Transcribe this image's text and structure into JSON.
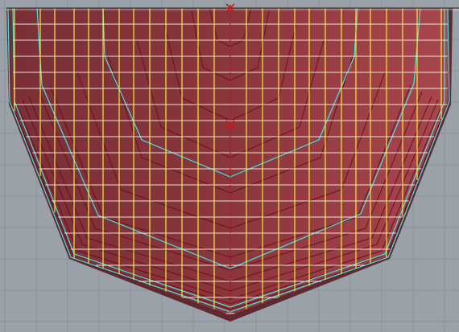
{
  "viewport": {
    "view": "3d-hull-viewport",
    "colors": {
      "background": "#9ba1a8",
      "background_grid": "#8c939b",
      "hull_fill": "#8f3a40",
      "hull_fill_light": "#a8454b",
      "hull_dark": "#5e2a30",
      "hull_edge": "#6e0f18",
      "waterline": "#ffffff",
      "station": "#f2e93a",
      "contour": "#47e4e6",
      "marker": "#d21414"
    },
    "icons": {
      "origin_marker": "x-marker-icon",
      "center_marker": "x-marker-icon"
    }
  }
}
